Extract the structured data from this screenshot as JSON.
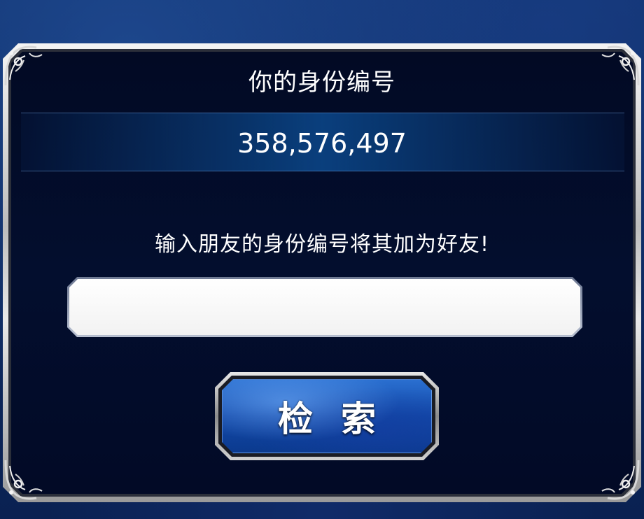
{
  "dialog": {
    "title": "你的身份编号",
    "user_id": "358,576,497",
    "instruction": "输入朋友的身份编号将其加为好友!",
    "input": {
      "value": "",
      "placeholder": ""
    },
    "search_button_label": "检索"
  },
  "icons": {
    "corner_ornament": "ornate-corner-icon"
  },
  "colors": {
    "background": "#0b2456",
    "panel": "#020a24",
    "id_band": "#0a3f7d",
    "frame_silver": "#cfcfcf",
    "button_blue": "#1248a8",
    "text": "#ffffff"
  }
}
